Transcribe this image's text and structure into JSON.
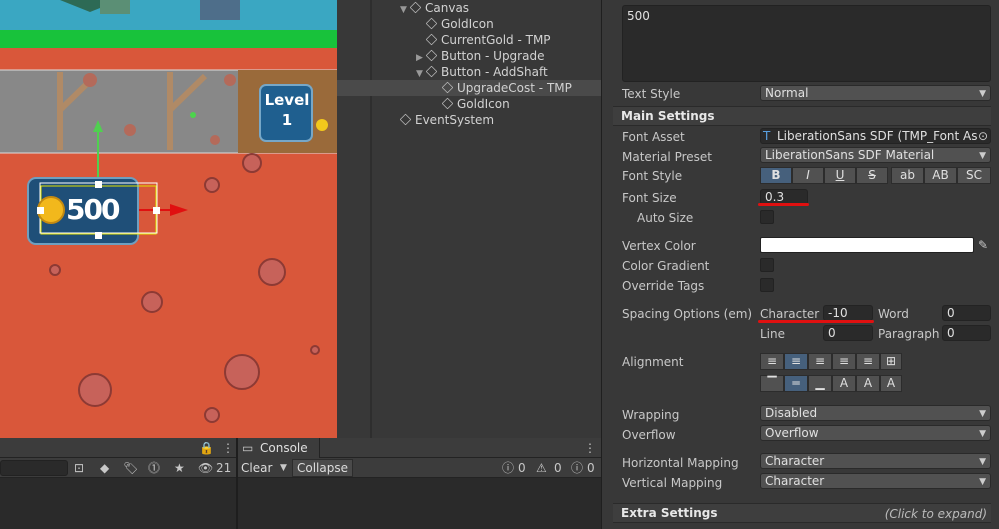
{
  "hierarchy": {
    "items": [
      {
        "label": "Canvas",
        "arrow": "▼"
      },
      {
        "label": "GoldIcon",
        "arrow": ""
      },
      {
        "label": "CurrentGold - TMP",
        "arrow": ""
      },
      {
        "label": "Button - Upgrade",
        "arrow": "▶"
      },
      {
        "label": "Button - AddShaft",
        "arrow": "▼"
      },
      {
        "label": "UpgradeCost - TMP",
        "arrow": ""
      },
      {
        "label": "GoldIcon",
        "arrow": ""
      },
      {
        "label": "EventSystem",
        "arrow": ""
      }
    ]
  },
  "scene": {
    "level_label": "Level",
    "level_number": "1",
    "gold_value": "500"
  },
  "inspector": {
    "text_value": "500",
    "text_style_label": "Text Style",
    "text_style_value": "Normal",
    "main_settings": "Main Settings",
    "font_asset_label": "Font Asset",
    "font_asset_value": "LiberationSans SDF (TMP_Font Ass",
    "material_preset_label": "Material Preset",
    "material_preset_value": "LiberationSans SDF Material",
    "font_style_label": "Font Style",
    "font_style_buttons": [
      "B",
      "I",
      "U",
      "S",
      "ab",
      "AB",
      "SC"
    ],
    "font_size_label": "Font Size",
    "font_size_value": "0.3",
    "auto_size_label": "Auto Size",
    "vertex_color_label": "Vertex Color",
    "color_gradient_label": "Color Gradient",
    "override_tags_label": "Override Tags",
    "spacing_label": "Spacing Options (em)",
    "character_label": "Character",
    "character_value": "-10",
    "word_label": "Word",
    "word_value": "0",
    "line_label": "Line",
    "line_value": "0",
    "paragraph_label": "Paragraph",
    "paragraph_value": "0",
    "alignment_label": "Alignment",
    "wrapping_label": "Wrapping",
    "wrapping_value": "Disabled",
    "overflow_label": "Overflow",
    "overflow_value": "Overflow",
    "h_mapping_label": "Horizontal Mapping",
    "h_mapping_value": "Character",
    "v_mapping_label": "Vertical Mapping",
    "v_mapping_value": "Character",
    "extra_settings": "Extra Settings",
    "extra_hint": "(Click to expand)"
  },
  "bottom": {
    "hidden_count": "21",
    "console_tab": "Console",
    "clear_label": "Clear",
    "collapse_label": "Collapse",
    "log_count": "0",
    "warn_count": "0",
    "error_count": "0"
  },
  "colors": {
    "accent_blue": "#46607c",
    "annotation_red": "#e01010"
  }
}
